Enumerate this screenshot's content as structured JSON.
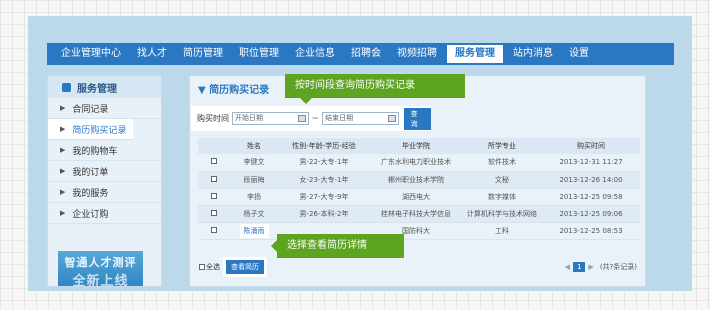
{
  "nav": {
    "items": [
      "企业管理中心",
      "找人才",
      "简历管理",
      "职位管理",
      "企业信息",
      "招聘会",
      "视频招聘",
      "服务管理",
      "站内消息",
      "设置"
    ],
    "active": "服务管理"
  },
  "sidebar": {
    "title": "服务管理",
    "items": [
      {
        "label": "合同记录"
      },
      {
        "label": "简历购买记录"
      },
      {
        "label": "我的购物车"
      },
      {
        "label": "我的订单"
      },
      {
        "label": "我的服务"
      },
      {
        "label": "企业订购"
      }
    ],
    "banner_line1": "智通人才测评",
    "banner_line2": "全新上线"
  },
  "main": {
    "title": "简历购买记录",
    "filter": {
      "label": "购买时间",
      "start_placeholder": "开始日期",
      "separator": "~",
      "end_placeholder": "结束日期",
      "query_label": "查询"
    },
    "table": {
      "headers": [
        "",
        "姓名",
        "性别-年龄-学历-经验",
        "毕业学院",
        "所学专业",
        "购买时间"
      ],
      "rows": [
        {
          "name": "李健文",
          "info": "男-22-大专-1年",
          "school": "广东水利电力职业技术",
          "major": "软件技术",
          "time": "2013-12-31 11:27"
        },
        {
          "name": "段丽梅",
          "info": "女-23-大专-1年",
          "school": "郴州职业技术学院",
          "major": "文秘",
          "time": "2013-12-26 14:00"
        },
        {
          "name": "李扬",
          "info": "男-27-大专-9年",
          "school": "湖西电大",
          "major": "数字媒体",
          "time": "2013-12-25 09:58"
        },
        {
          "name": "杨子文",
          "info": "男-26-本科-2年",
          "school": "桂林电子科技大学信息",
          "major": "计算机科学与技术网络",
          "time": "2013-12-25 09:06"
        },
        {
          "name": "陈涌雨",
          "info": "",
          "school": "国防科大",
          "major": "工科",
          "time": "2013-12-25 08:53"
        }
      ]
    },
    "select_all_label": "全选",
    "view_resume_label": "查看简历",
    "pager": {
      "prev": "◀",
      "page": "1",
      "next": "▶",
      "total": "(共?条记录)"
    }
  },
  "callouts": {
    "top": "按时间段查询简历购买记录",
    "bottom": "选择查看简历详情"
  },
  "colors": {
    "brand": "#2a77c2",
    "callout": "#5da420",
    "frame": "#bcd9ec"
  }
}
